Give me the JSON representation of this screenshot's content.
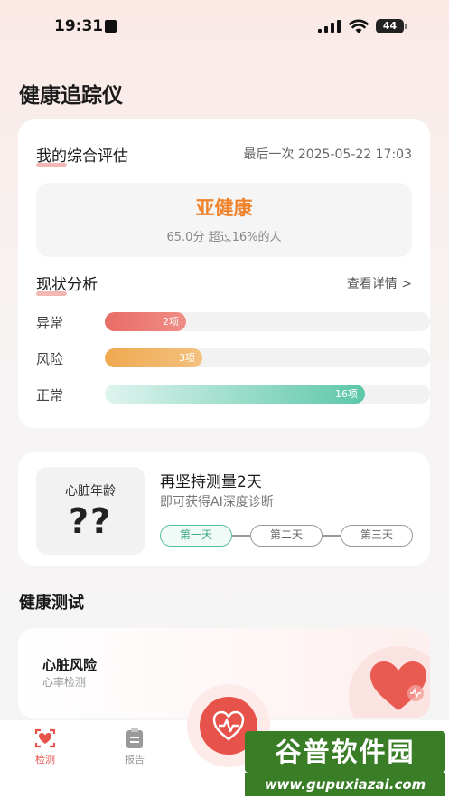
{
  "status_bar": {
    "time": "19:31",
    "battery": "44"
  },
  "page": {
    "title": "健康追踪仪"
  },
  "assessment": {
    "title": "我的综合评估",
    "last_time": "最后一次 2025-05-22 17:03",
    "status": "亚健康",
    "score_text": "65.0分  超过16%的人",
    "status_color": "#f0832b"
  },
  "analysis": {
    "title": "现状分析",
    "detail_link": "查看详情 >",
    "bars": [
      {
        "label": "异常",
        "count_text": "2项",
        "fraction": 0.25
      },
      {
        "label": "风险",
        "count_text": "3项",
        "fraction": 0.3
      },
      {
        "label": "正常",
        "count_text": "16项",
        "fraction": 0.8
      }
    ]
  },
  "heart_age": {
    "label": "心脏年龄",
    "value": "??",
    "title": "再坚持测量2天",
    "subtitle": "即可获得AI深度诊断",
    "days": [
      "第一天",
      "第二天",
      "第三天"
    ],
    "active_day": 0
  },
  "health_test": {
    "section_title": "健康测试",
    "item_name": "心脏风险",
    "item_sub": "心率检测"
  },
  "tabbar": {
    "tabs": [
      {
        "label": "检测",
        "active": true
      },
      {
        "label": "报告",
        "active": false
      }
    ],
    "active_color": "#e7524a",
    "inactive_color": "#999999"
  },
  "watermark": {
    "top": "谷普软件园",
    "bottom": "www.gupuxiazai.com"
  }
}
